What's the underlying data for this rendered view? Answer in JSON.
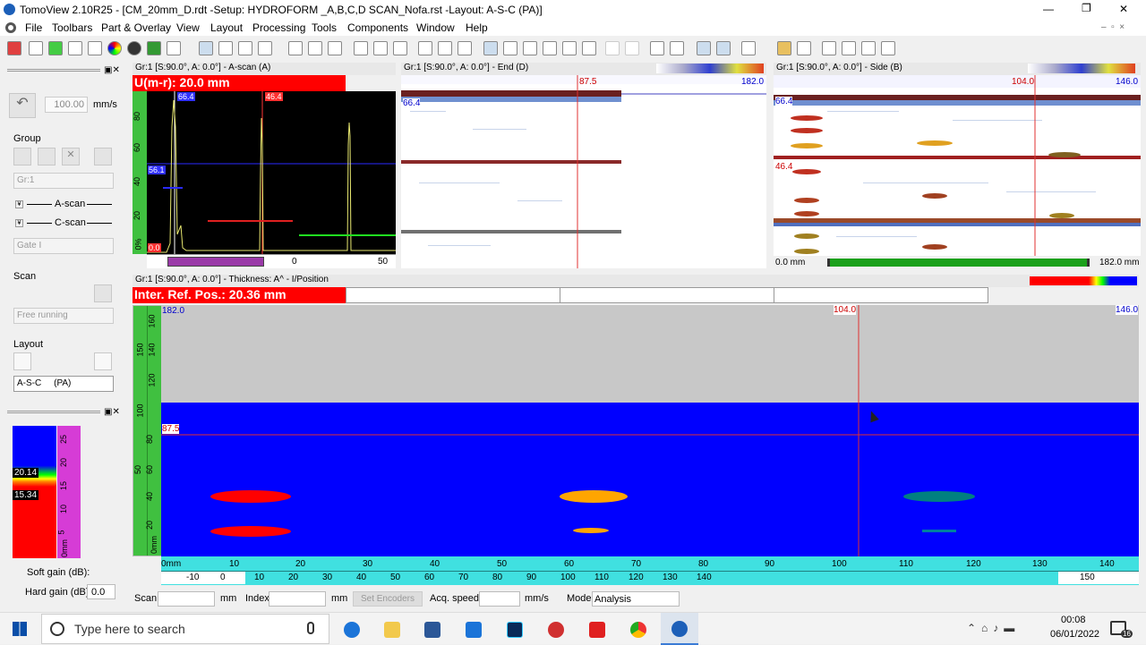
{
  "window": {
    "title": "TomoView 2.10R25 - [CM_20mm_D.rdt -Setup: HYDROFORM _A,B,C,D SCAN_Nofa.rst -Layout: A-S-C     (PA)]",
    "controls": [
      "—",
      "❐",
      "✕"
    ]
  },
  "menu": [
    "File",
    "Toolbars",
    "Part & Overlay",
    "View",
    "Layout",
    "Processing",
    "Tools",
    "Components",
    "Window",
    "Help"
  ],
  "left": {
    "speed_value": "100.00",
    "speed_unit": "mm/s",
    "group_label": "Group",
    "group_select": "Gr:1",
    "ascan_label": "A-scan",
    "cscan_label": "C-scan",
    "gate_select": "Gate I",
    "scan_label": "Scan",
    "scan_mode": "Free running",
    "layout_label": "Layout",
    "layout_select": "A-S-C     (PA)",
    "cbar_top": "20.14",
    "cbar_bot": "15.34",
    "cbar_ticks": [
      "25",
      "20",
      "15",
      "10",
      "5",
      "0mm"
    ],
    "soft_gain": "Soft gain (dB):",
    "hard_gain": "Hard gain (dB):",
    "hard_gain_val": "0.0"
  },
  "ascan": {
    "title": "Gr:1 [S:90.0°, A: 0.0°] - A-scan (A)",
    "banner": "U(m-r): 20.0 mm",
    "cursor1": "66.4",
    "cursor2": "46.4",
    "level": "56.1",
    "zero": "0.0",
    "xticks": [
      "0",
      "50"
    ],
    "yticks": [
      "80",
      "60",
      "40",
      "20",
      "0%"
    ]
  },
  "end": {
    "title": "Gr:1 [S:90.0°, A: 0.0°] - End (D)",
    "top_left": "87.5",
    "top_right": "182.0",
    "marker": "66.4"
  },
  "side": {
    "title": "Gr:1 [S:90.0°, A: 0.0°] - Side (B)",
    "top_mid": "104.0",
    "top_right": "146.0",
    "m1": "66.4",
    "m2": "46.4",
    "scroll_left": "0.0 mm",
    "scroll_right": "182.0 mm"
  },
  "cscan": {
    "title": "Gr:1 [S:90.0°, A: 0.0°] - Thickness: A^ - I/Position",
    "banner": "Inter. Ref. Pos.: 20.36 mm",
    "top_left": "182.0",
    "top_mid": "104.0",
    "top_right": "146.0",
    "hline": "87.5",
    "yticks": [
      "160",
      "150",
      "140",
      "120",
      "100",
      "80",
      "60",
      "50",
      "40",
      "20",
      "0mm"
    ],
    "xticks": [
      "0mm",
      "10",
      "20",
      "30",
      "40",
      "50",
      "60",
      "70",
      "80",
      "90",
      "100",
      "110",
      "120",
      "130",
      "140"
    ],
    "xticks2": [
      "-10",
      "0",
      "10",
      "20",
      "30",
      "40",
      "50",
      "60",
      "70",
      "80",
      "90",
      "100",
      "110",
      "120",
      "130",
      "140",
      "150"
    ]
  },
  "status": {
    "scan": "Scan",
    "mm": "mm",
    "index": "Index",
    "mm2": "mm",
    "set_encoders": "Set Encoders",
    "acq_speed": "Acq. speed",
    "mms": "mm/s",
    "mode": "Mode",
    "mode_val": "Analysis"
  },
  "taskbar": {
    "search": "Type here to search",
    "time": "00:08",
    "date": "06/01/2022",
    "notif": "16"
  }
}
